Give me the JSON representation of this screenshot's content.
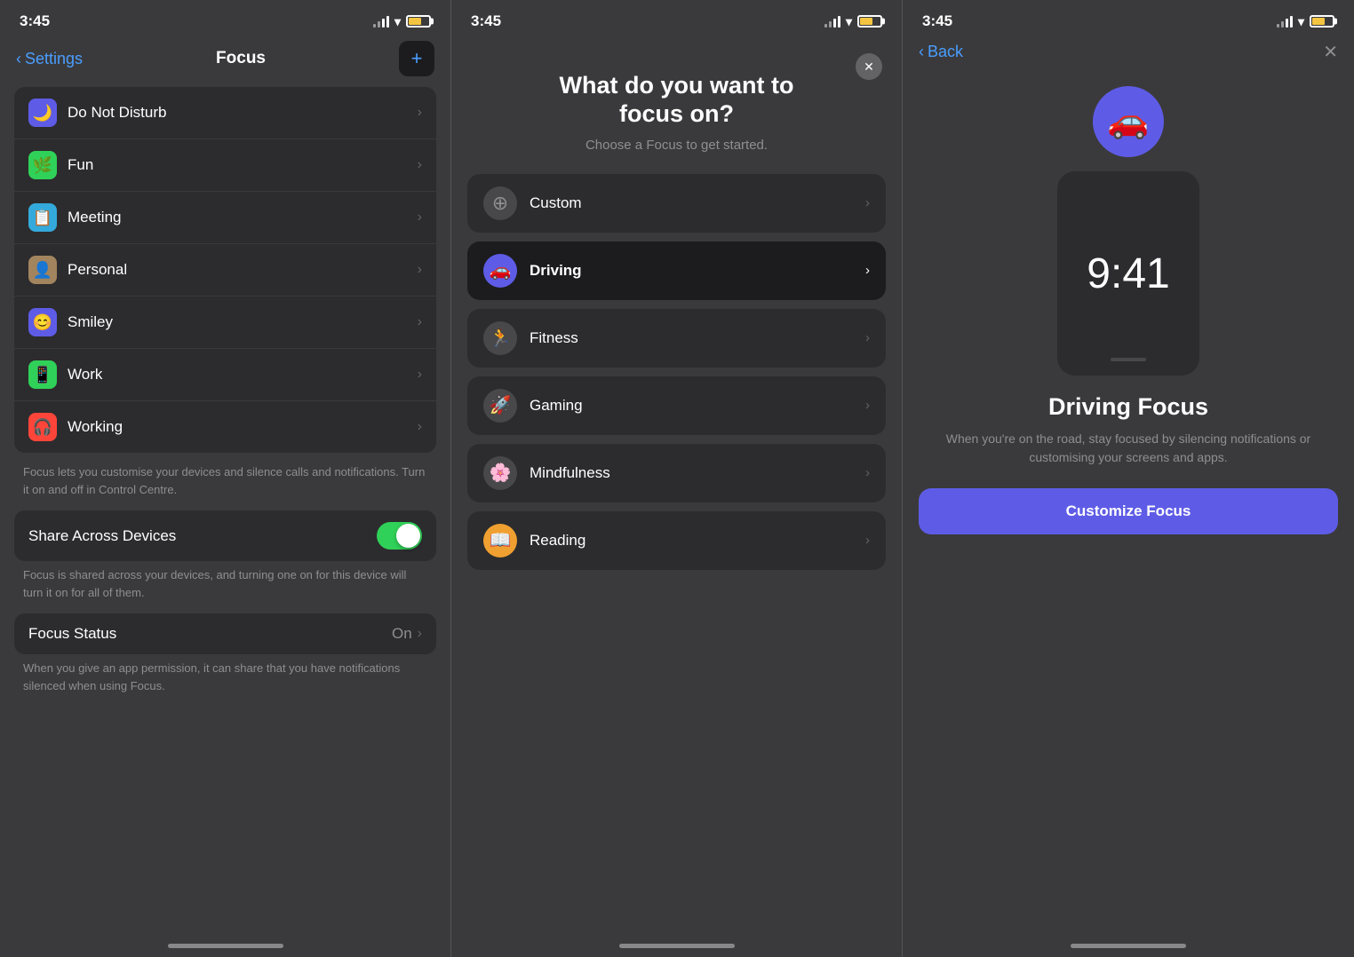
{
  "panel1": {
    "time": "3:45",
    "back_label": "Settings",
    "title": "Focus",
    "add_label": "+",
    "items": [
      {
        "id": "do-not-disturb",
        "icon": "🌙",
        "icon_bg": "#5e5ce6",
        "label": "Do Not Disturb"
      },
      {
        "id": "fun",
        "icon": "🌿",
        "icon_bg": "#30d158",
        "label": "Fun"
      },
      {
        "id": "meeting",
        "icon": "📋",
        "icon_bg": "#34aadc",
        "label": "Meeting"
      },
      {
        "id": "personal",
        "icon": "👤",
        "icon_bg": "#a2845e",
        "label": "Personal"
      },
      {
        "id": "smiley",
        "icon": "😊",
        "icon_bg": "#5e5ce6",
        "label": "Smiley"
      },
      {
        "id": "work",
        "icon": "📱",
        "icon_bg": "#30d158",
        "label": "Work"
      },
      {
        "id": "working",
        "icon": "🎧",
        "icon_bg": "#ff453a",
        "label": "Working"
      }
    ],
    "info_text": "Focus lets you customise your devices and silence calls and notifications. Turn it on and off in Control Centre.",
    "share_devices_label": "Share Across Devices",
    "share_info": "Focus is shared across your devices, and turning one on for this device will turn it on for all of them.",
    "focus_status_label": "Focus Status",
    "focus_status_value": "On",
    "focus_status_info": "When you give an app permission, it can share that you have notifications silenced when using Focus."
  },
  "panel2": {
    "time": "3:45",
    "close_icon": "✕",
    "title": "What do you want to\nfocus on?",
    "subtitle": "Choose a Focus to get started.",
    "items": [
      {
        "id": "custom",
        "icon": "⊕",
        "icon_bg": "#48484a",
        "label": "Custom",
        "active": false
      },
      {
        "id": "driving",
        "icon": "🚗",
        "icon_bg": "#5e5ce6",
        "label": "Driving",
        "active": true
      },
      {
        "id": "fitness",
        "icon": "🏃",
        "icon_bg": "#48484a",
        "label": "Fitness",
        "active": false
      },
      {
        "id": "gaming",
        "icon": "🚀",
        "icon_bg": "#48484a",
        "label": "Gaming",
        "active": false
      },
      {
        "id": "mindfulness",
        "icon": "🌸",
        "icon_bg": "#48484a",
        "label": "Mindfulness",
        "active": false
      },
      {
        "id": "reading",
        "icon": "📖",
        "icon_bg": "#f0a030",
        "label": "Reading",
        "active": false
      }
    ]
  },
  "panel3": {
    "time": "3:45",
    "back_label": "Back",
    "close_icon": "✕",
    "driving_icon": "🚗",
    "phone_time": "9:41",
    "title": "Driving Focus",
    "description": "When you're on the road, stay focused by silencing notifications or customising your screens and apps.",
    "customize_btn": "Customize Focus"
  }
}
